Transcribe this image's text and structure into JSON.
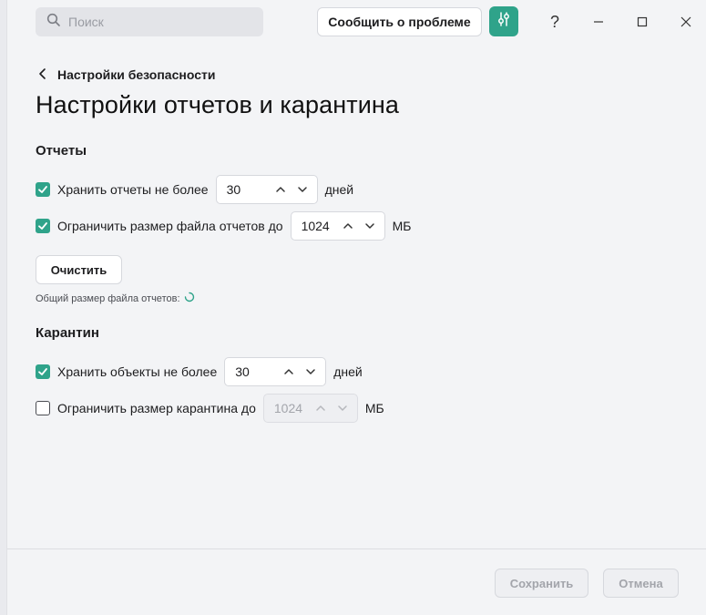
{
  "topbar": {
    "search_placeholder": "Поиск",
    "report_problem": "Сообщить о проблеме",
    "help": "?"
  },
  "breadcrumb": {
    "back_label": "Настройки безопасности"
  },
  "page": {
    "title": "Настройки отчетов и карантина"
  },
  "reports": {
    "title": "Отчеты",
    "keep_reports": {
      "checked": true,
      "label": "Хранить отчеты не более",
      "value": "30",
      "unit": "дней"
    },
    "limit_file": {
      "checked": true,
      "label": "Ограничить размер файла отчетов до",
      "value": "1024",
      "unit": "МБ"
    },
    "clear_button": "Очистить",
    "total_size_label": "Общий размер файла отчетов:"
  },
  "quarantine": {
    "title": "Карантин",
    "keep_objects": {
      "checked": true,
      "label": "Хранить объекты не более",
      "value": "30",
      "unit": "дней"
    },
    "limit_size": {
      "checked": false,
      "label": "Ограничить размер карантина до",
      "value": "1024",
      "unit": "МБ"
    }
  },
  "footer": {
    "save": "Сохранить",
    "cancel": "Отмена"
  },
  "colors": {
    "accent": "#2fa38a",
    "background": "#f3f4f6"
  }
}
